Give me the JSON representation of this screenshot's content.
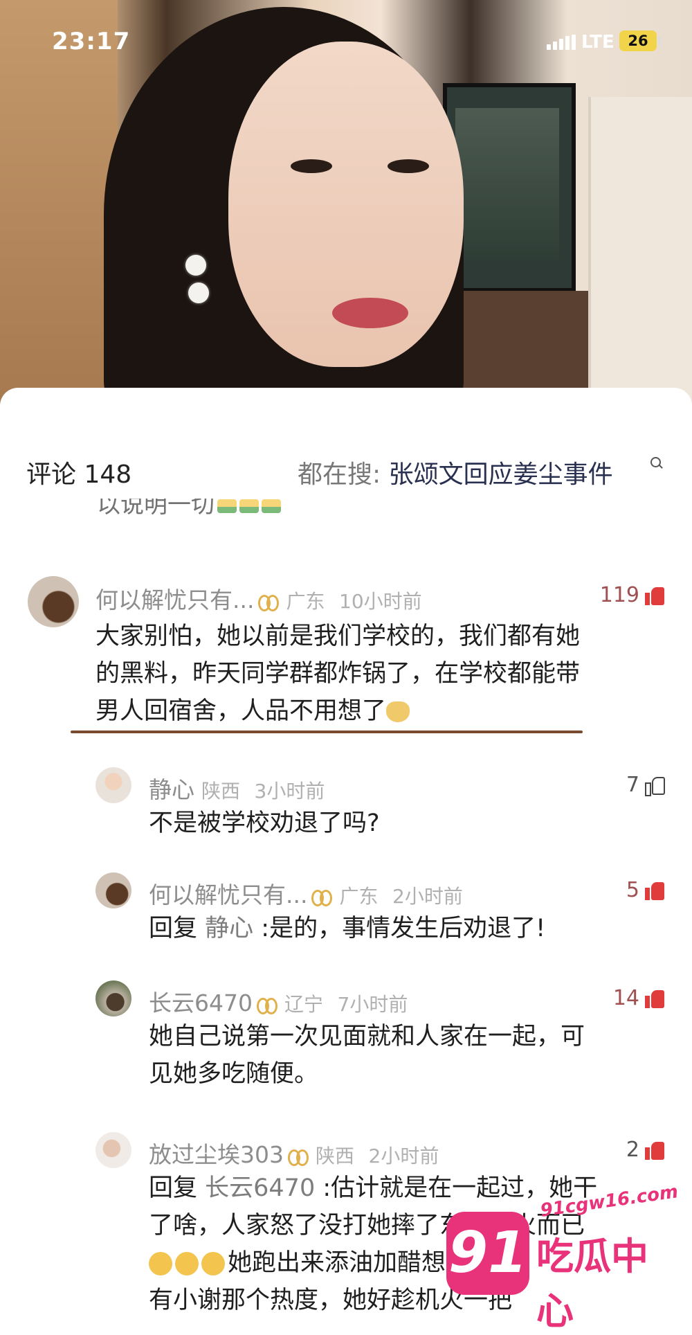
{
  "status_bar": {
    "time": "23:17",
    "network": "LTE",
    "battery": "26"
  },
  "header": {
    "comments_label": "评论 148",
    "hot_search_prefix": "都在搜: ",
    "hot_search_query": "张颂文回应姜尘事件"
  },
  "previous_comment_tail": "以说明一切",
  "comments": [
    {
      "user": "何以解忧只有...",
      "location": "广东",
      "time": "10小时前",
      "likes": "119",
      "liked": true,
      "lines": [
        "大家别怕，她以前是我们学校的，我们都有她",
        "的黑料，昨天同学群都炸锅了，在学校都能带",
        "男人回宿舍，人品不用想了"
      ]
    },
    {
      "user": "静心",
      "location": "陕西",
      "time": "3小时前",
      "likes": "7",
      "liked": false,
      "lines": [
        "不是被学校劝退了吗?"
      ]
    },
    {
      "user": "何以解忧只有...",
      "location": "广东",
      "time": "2小时前",
      "likes": "5",
      "liked": true,
      "reply_prefix": "回复 ",
      "reply_to": "静心",
      "lines": [
        " :是的，事情发生后劝退了!"
      ]
    },
    {
      "user": "长云6470",
      "location": "辽宁",
      "time": "7小时前",
      "likes": "14",
      "liked": true,
      "lines": [
        "她自己说第一次见面就和人家在一起，可",
        "见她多吃随便。"
      ]
    },
    {
      "user": "放过尘埃303",
      "location": "陕西",
      "time": "2小时前",
      "likes": "2",
      "liked": true,
      "reply_prefix": "回复 ",
      "reply_to": "长云6470",
      "lines": [
        " :估计就是在一起过，她干",
        "了啥，人家怒了没打她摔了东西发火而已",
        "她跑出来添油加醋想红",
        "有小谢那个热度，她好趁机火一把"
      ]
    }
  ],
  "watermark": {
    "url": "91cgw16.com",
    "number": "91",
    "name": "吃瓜中心"
  },
  "colors": {
    "accent": "#e03c3c",
    "watermark": "#e8337a",
    "badge": "#e0b14a"
  }
}
